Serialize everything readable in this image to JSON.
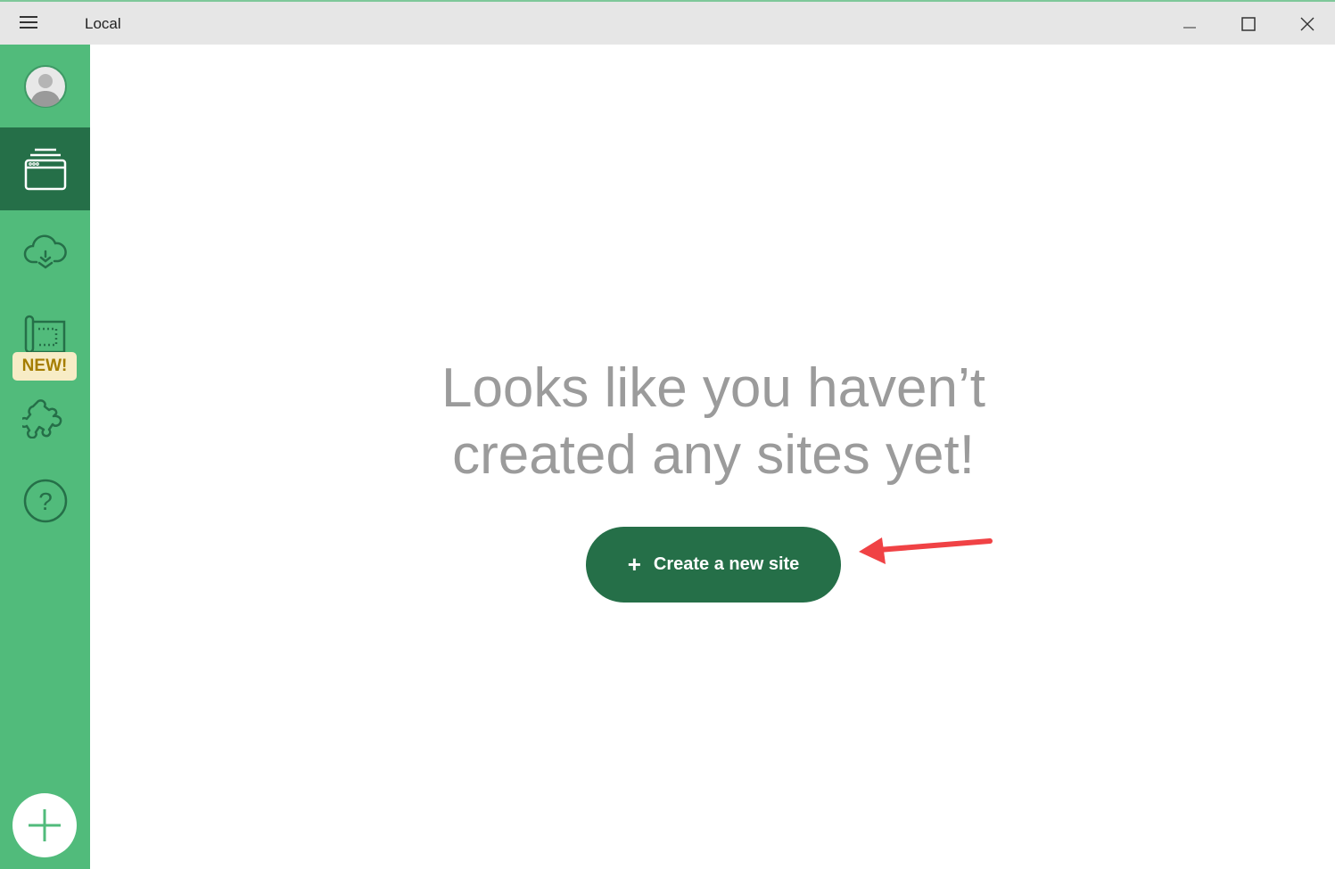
{
  "window": {
    "title": "Local"
  },
  "sidebar": {
    "new_badge": "NEW!",
    "items": [
      {
        "icon": "avatar"
      },
      {
        "icon": "sites-icon",
        "active": true
      },
      {
        "icon": "cloud-download-icon"
      },
      {
        "icon": "blueprint-icon"
      },
      {
        "icon": "addons-puzzle-icon"
      },
      {
        "icon": "help-icon"
      }
    ]
  },
  "main": {
    "message_line1": "Looks like you haven’t",
    "message_line2": "created any sites yet!",
    "create_button": "Create a new site",
    "create_icon": "+"
  },
  "colors": {
    "sidebar": "#51bb7b",
    "accent_dark": "#256f48",
    "badge_bg": "#f7ecc6",
    "arrow": "#f04245"
  }
}
